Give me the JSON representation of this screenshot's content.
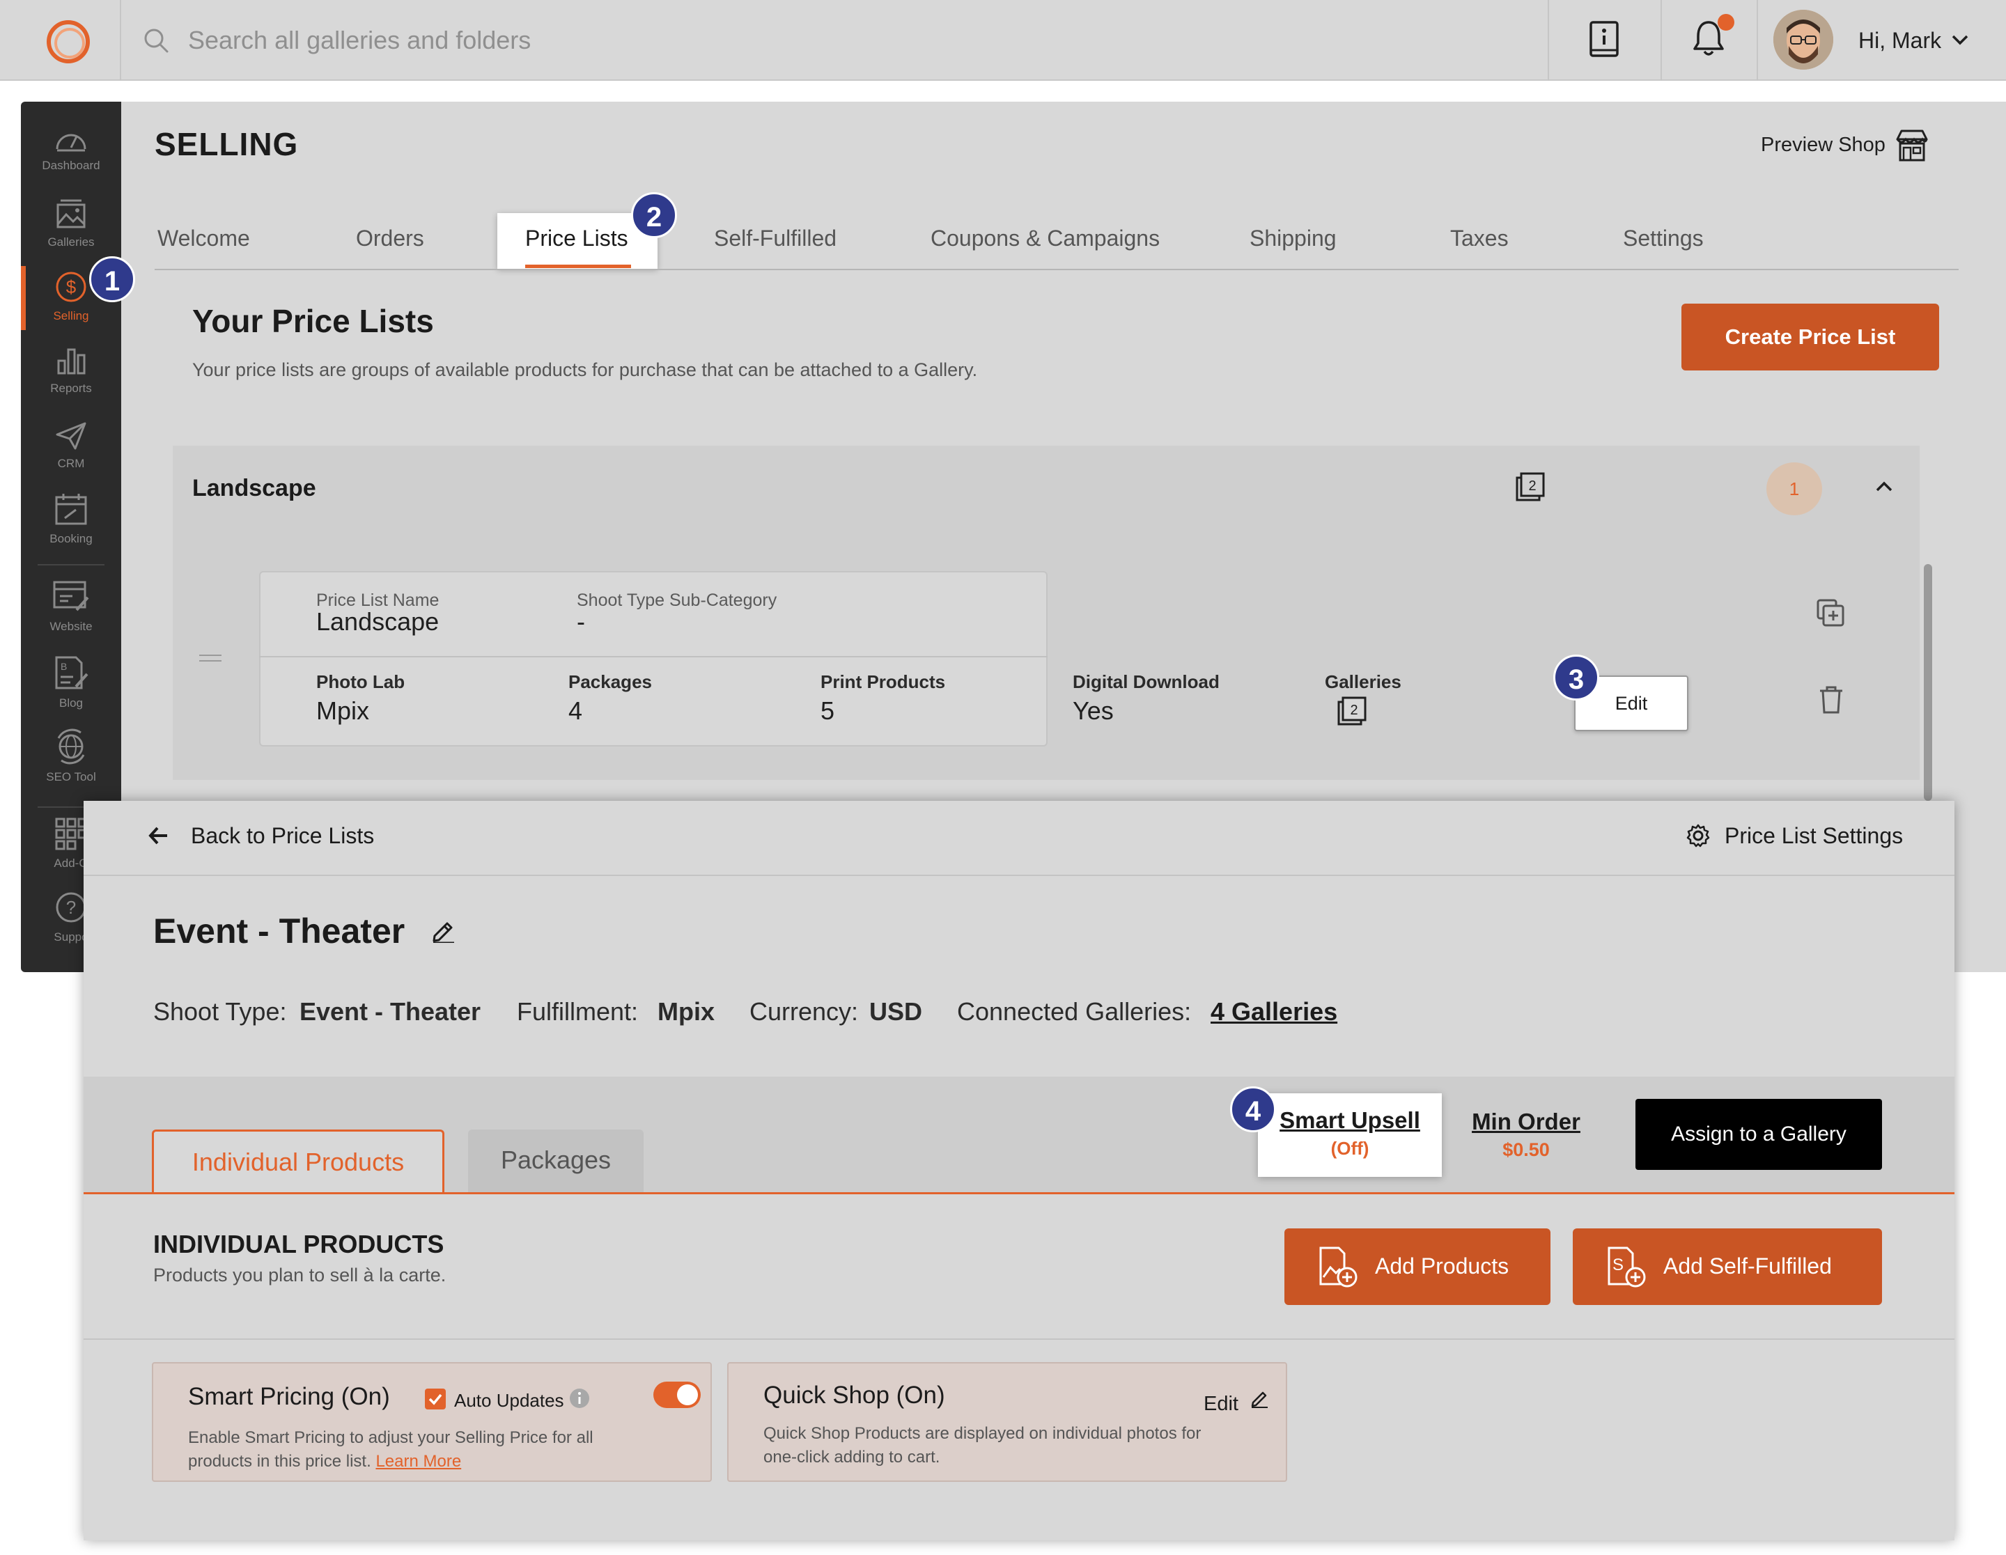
{
  "topbar": {
    "search_placeholder": "Search all galleries and folders",
    "greeting": "Hi, Mark"
  },
  "sidebar": {
    "items": [
      {
        "label": "Dashboard",
        "icon": "dashboard-icon"
      },
      {
        "label": "Galleries",
        "icon": "galleries-icon"
      },
      {
        "label": "Selling",
        "icon": "dollar-icon",
        "active": true
      },
      {
        "label": "Reports",
        "icon": "bar-chart-icon"
      },
      {
        "label": "CRM",
        "icon": "send-icon"
      },
      {
        "label": "Booking",
        "icon": "calendar-icon"
      },
      {
        "label": "Website",
        "icon": "website-icon"
      },
      {
        "label": "Blog",
        "icon": "blog-icon"
      },
      {
        "label": "SEO Tool",
        "icon": "seo-icon"
      },
      {
        "label": "Add-O",
        "icon": "grid-icon"
      },
      {
        "label": "Suppo",
        "icon": "help-icon"
      }
    ]
  },
  "selling": {
    "title": "SELLING",
    "preview_shop": "Preview Shop",
    "tabs": [
      "Welcome",
      "Orders",
      "Price Lists",
      "Self-Fulfilled",
      "Coupons & Campaigns",
      "Shipping",
      "Taxes",
      "Settings"
    ],
    "active_tab": "Price Lists",
    "section_title": "Your Price Lists",
    "section_sub": "Your price lists are groups of available products for purchase that can be attached to a Gallery.",
    "create_button": "Create Price List",
    "group": {
      "name": "Landscape",
      "gallery_count": "2",
      "badge_count": "1",
      "card": {
        "name_label": "Price List Name",
        "name_value": "Landscape",
        "subcat_label": "Shoot Type Sub-Category",
        "subcat_value": "-",
        "photo_lab_label": "Photo Lab",
        "photo_lab_value": "Mpix",
        "packages_label": "Packages",
        "packages_value": "4",
        "print_label": "Print Products",
        "print_value": "5",
        "digital_label": "Digital Download",
        "digital_value": "Yes",
        "galleries_label": "Galleries",
        "galleries_value": "2",
        "edit_label": "Edit"
      }
    }
  },
  "steps": [
    "1",
    "2",
    "3",
    "4"
  ],
  "price_list": {
    "back_label": "Back to Price Lists",
    "settings_label": "Price List Settings",
    "title": "Event - Theater",
    "shoot_type_label": "Shoot Type:",
    "shoot_type_value": "Event - Theater",
    "fulfillment_label": "Fulfillment:",
    "fulfillment_value": "Mpix",
    "currency_label": "Currency:",
    "currency_value": "USD",
    "connected_label": "Connected Galleries:",
    "connected_value": "4 Galleries",
    "tabs": [
      "Individual Products",
      "Packages"
    ],
    "smart_upsell_label": "Smart Upsell",
    "smart_upsell_status": "(Off)",
    "min_order_label": "Min Order",
    "min_order_value": "$0.50",
    "assign_button": "Assign to a Gallery",
    "section_title": "INDIVIDUAL PRODUCTS",
    "section_sub": "Products you plan to sell à la carte.",
    "add_products": "Add Products",
    "add_self_fulfilled": "Add Self-Fulfilled",
    "smart_pricing": {
      "title": "Smart Pricing (On)",
      "auto_updates": "Auto Updates",
      "auto_updates_checked": true,
      "toggle_on": true,
      "desc_line1": "Enable Smart Pricing to adjust your Selling Price for all",
      "desc_line2": "products in this price list.",
      "learn_more": "Learn More"
    },
    "quick_shop": {
      "title": "Quick Shop (On)",
      "edit": "Edit",
      "desc_line1": "Quick Shop Products are displayed on individual photos for",
      "desc_line2": "one-click adding to cart."
    }
  },
  "colors": {
    "accent": "#e2622b",
    "button_orange": "#c95524",
    "step_marker": "#2f3a8c",
    "sidebar_bg": "#2b2b2b"
  }
}
